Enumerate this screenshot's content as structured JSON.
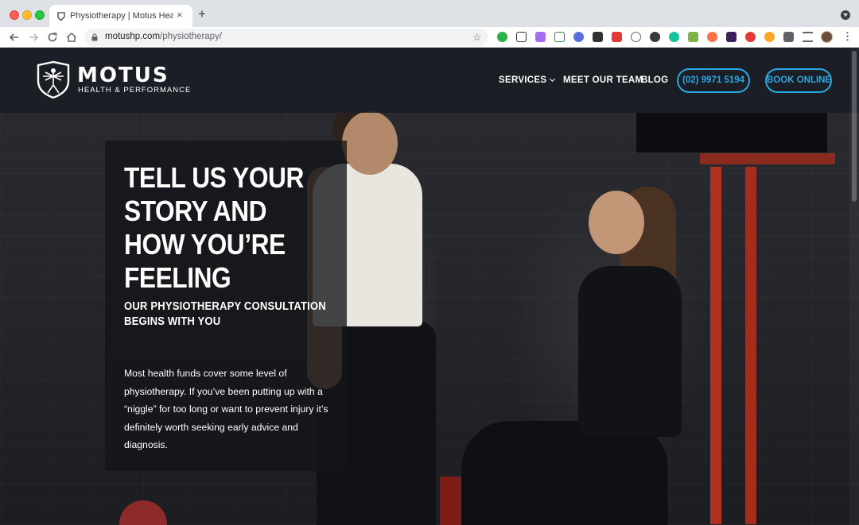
{
  "browser": {
    "tab_title": "Physiotherapy | Motus Health & Performance",
    "tab_close": "×",
    "new_tab": "+",
    "url_host": "motushp.com",
    "url_path": "/physiotherapy/",
    "star": "☆",
    "menu": "⋮"
  },
  "header": {
    "logo_name": "MOTUS",
    "logo_tagline": "HEALTH & PERFORMANCE",
    "nav": {
      "services": "SERVICES",
      "team": "MEET OUR TEAM",
      "blog": "BLOG"
    },
    "phone": "(02) 9971 5194",
    "book": "BOOK ONLINE"
  },
  "hero": {
    "title_lines": [
      "TELL US YOUR",
      "STORY AND",
      "HOW YOU’RE",
      "FEELING"
    ],
    "subtitle_lines": [
      "OUR PHYSIOTHERAPY CONSULTATION",
      "BEGINS WITH YOU"
    ],
    "body": "Most health funds cover some level of physiotherapy. If you’ve been putting up with a “niggle” for too long or want to prevent injury it’s definitely worth seeking early advice and diagnosis."
  },
  "colors": {
    "accent": "#29a7e1",
    "header_bg": "#1a1c26",
    "card_bg": "#131418"
  }
}
